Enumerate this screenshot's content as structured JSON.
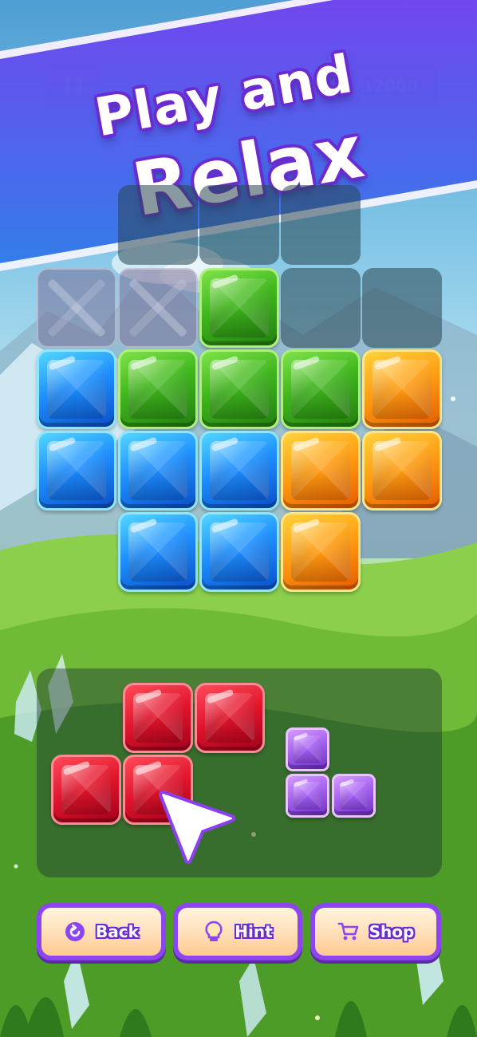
{
  "banner": {
    "line1": "Play and",
    "line2": "Relax",
    "colors": {
      "band_start": "#7a3cf0",
      "band_end": "#2f7bea",
      "text_outline": "#6a2bd1"
    }
  },
  "hud": {
    "score": "12000",
    "pause_icon": "pause-icon",
    "score_icon": "bomb-icon"
  },
  "board": {
    "rows": [
      [
        "empty",
        "empty",
        "empty",
        "empty",
        "empty"
      ],
      [
        "ghost",
        "ghost",
        "green",
        "empty",
        "empty"
      ],
      [
        "blue",
        "green",
        "green",
        "green",
        "orange"
      ],
      [
        "blue",
        "blue",
        "blue",
        "orange",
        "orange"
      ],
      [
        "none",
        "blue",
        "blue",
        "orange",
        "none"
      ]
    ],
    "top_row_visible": [
      false,
      true,
      true,
      true,
      false
    ]
  },
  "tray": {
    "pieces": [
      {
        "color": "red",
        "shape": "S-tetromino",
        "cells": [
          [
            0,
            1
          ],
          [
            0,
            2
          ],
          [
            1,
            0
          ],
          [
            1,
            1
          ]
        ]
      },
      {
        "color": "purple",
        "shape": "L-tromino",
        "cells": [
          [
            0,
            0
          ],
          [
            1,
            0
          ],
          [
            1,
            1
          ]
        ]
      }
    ]
  },
  "buttons": [
    {
      "id": "back",
      "label": "Back",
      "icon": "back-arrow-icon"
    },
    {
      "id": "hint",
      "label": "Hint",
      "icon": "lightbulb-icon"
    },
    {
      "id": "shop",
      "label": "Shop",
      "icon": "cart-icon"
    }
  ]
}
